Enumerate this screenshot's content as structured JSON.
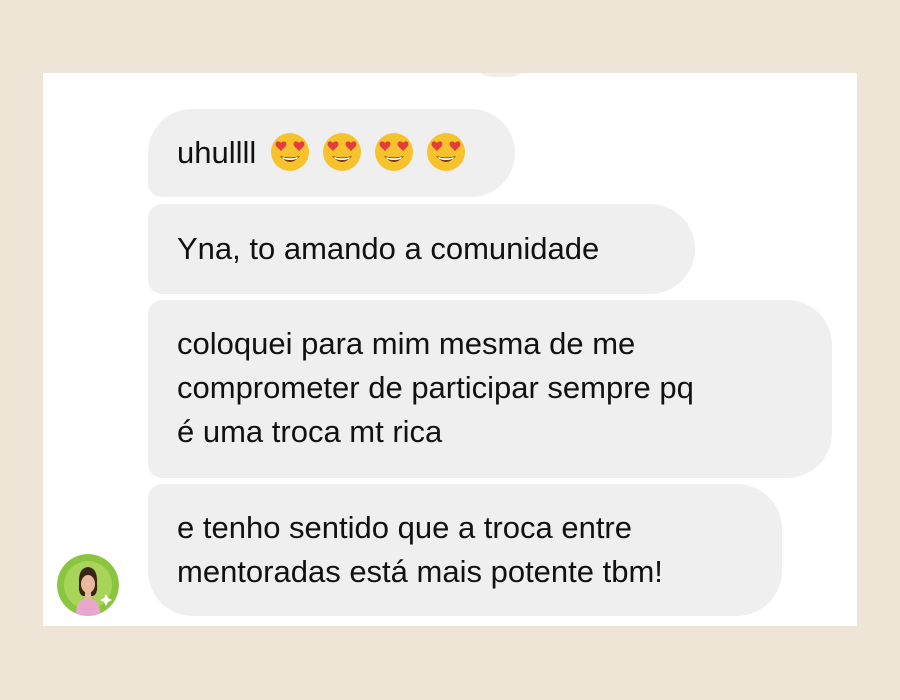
{
  "messages": [
    {
      "text": "uhullll",
      "emojis": [
        "heart-eyes",
        "heart-eyes",
        "heart-eyes",
        "heart-eyes"
      ]
    },
    {
      "text": "Yna, to amando a comunidade"
    },
    {
      "text": "coloquei para mim mesma de me\ncomprometer de participar sempre pq\né uma troca mt rica"
    },
    {
      "text": "e tenho sentido que a troca entre\nmentoradas está mais potente tbm!"
    }
  ],
  "colors": {
    "page_background": "#efe5d6",
    "card_background": "#ffffff",
    "bubble_background": "#efefef",
    "text": "#111111",
    "emoji_face": "#f8c22d",
    "emoji_hearts": "#e43b3f",
    "avatar_ring": "#8bc53f"
  },
  "avatar": {
    "icon": "sender-avatar-icon"
  }
}
